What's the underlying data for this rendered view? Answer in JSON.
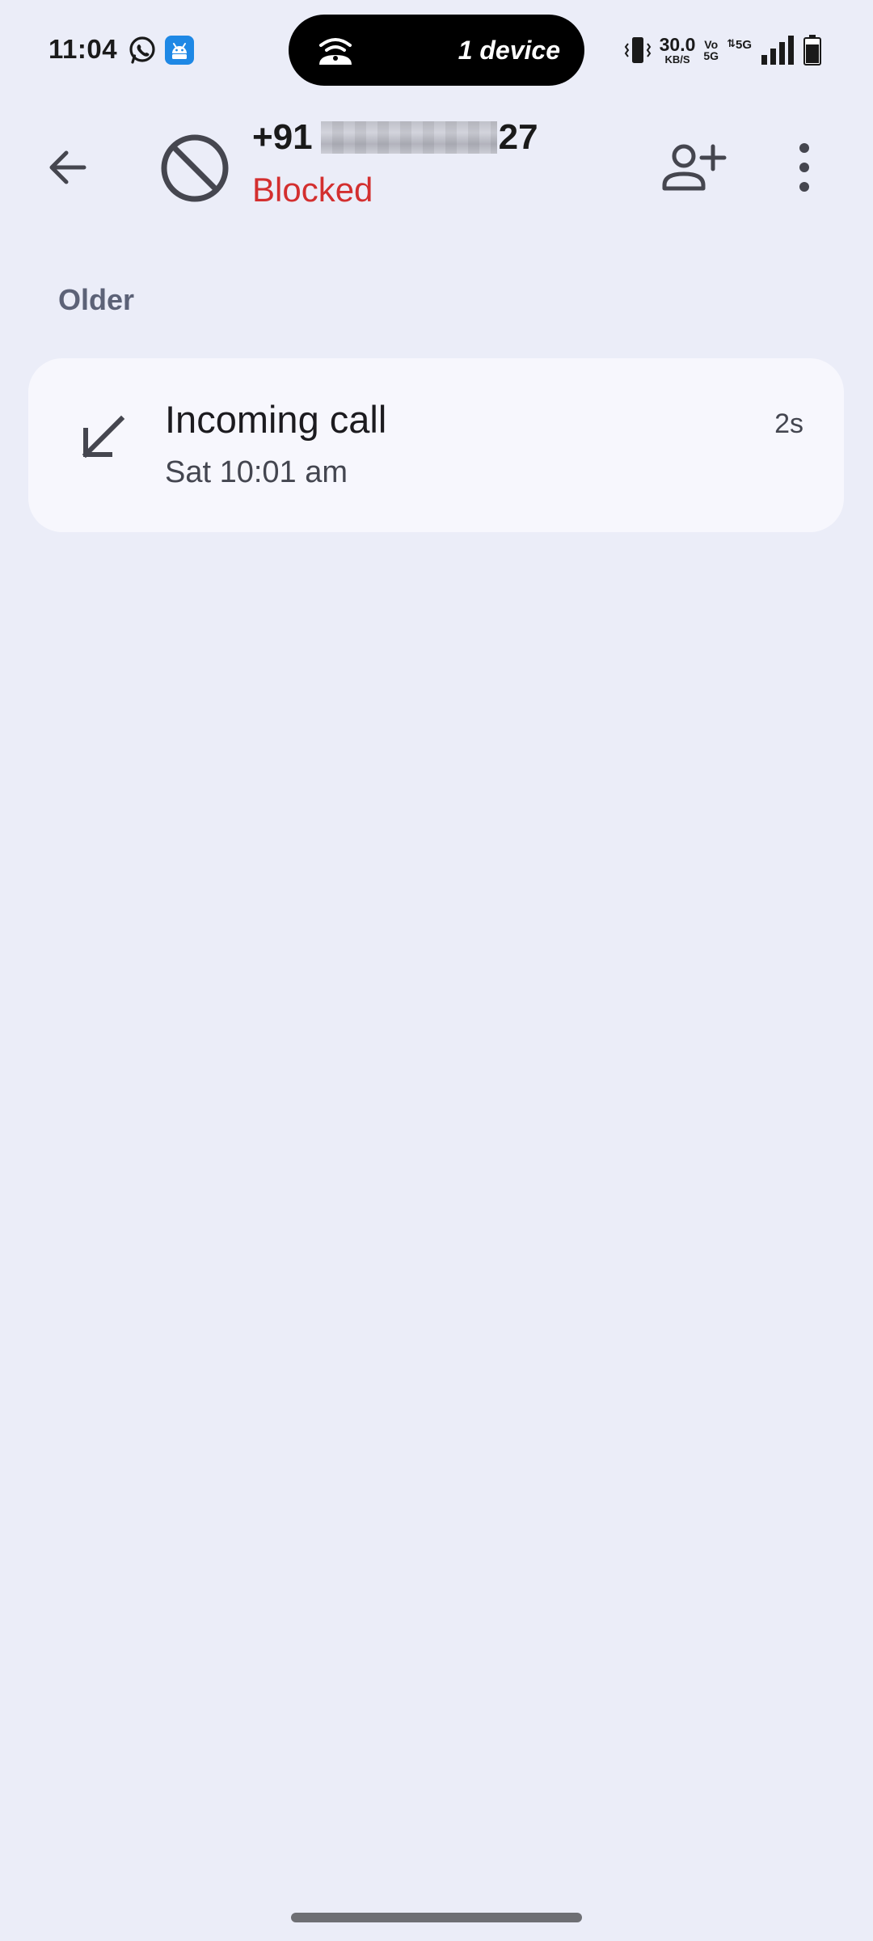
{
  "status_bar": {
    "time": "11:04",
    "notification_icons": [
      "whatsapp-icon",
      "android-icon"
    ],
    "hotspot": {
      "icon": "hotspot-icon",
      "label": "1 device"
    },
    "net_speed": {
      "value": "30.0",
      "unit": "KB/S"
    },
    "volte_top": "Vo",
    "volte_bottom": "5G",
    "network_type": "5G",
    "icons": [
      "vibrate-icon",
      "signal-icon",
      "battery-icon"
    ]
  },
  "app_bar": {
    "number_prefix": "+91",
    "number_suffix": "27",
    "status": "Blocked",
    "status_color": "#d32f2f",
    "icons": [
      "back-arrow-icon",
      "blocked-icon",
      "add-contact-icon",
      "more-vert-icon"
    ]
  },
  "history": {
    "section_label": "Older",
    "calls": [
      {
        "type": "Incoming call",
        "time": "Sat 10:01 am",
        "duration": "2s",
        "icon": "incoming-call-arrow-icon"
      }
    ]
  },
  "colors": {
    "background": "#ebedf8",
    "card": "#f7f7fd",
    "blocked": "#d32f2f"
  }
}
